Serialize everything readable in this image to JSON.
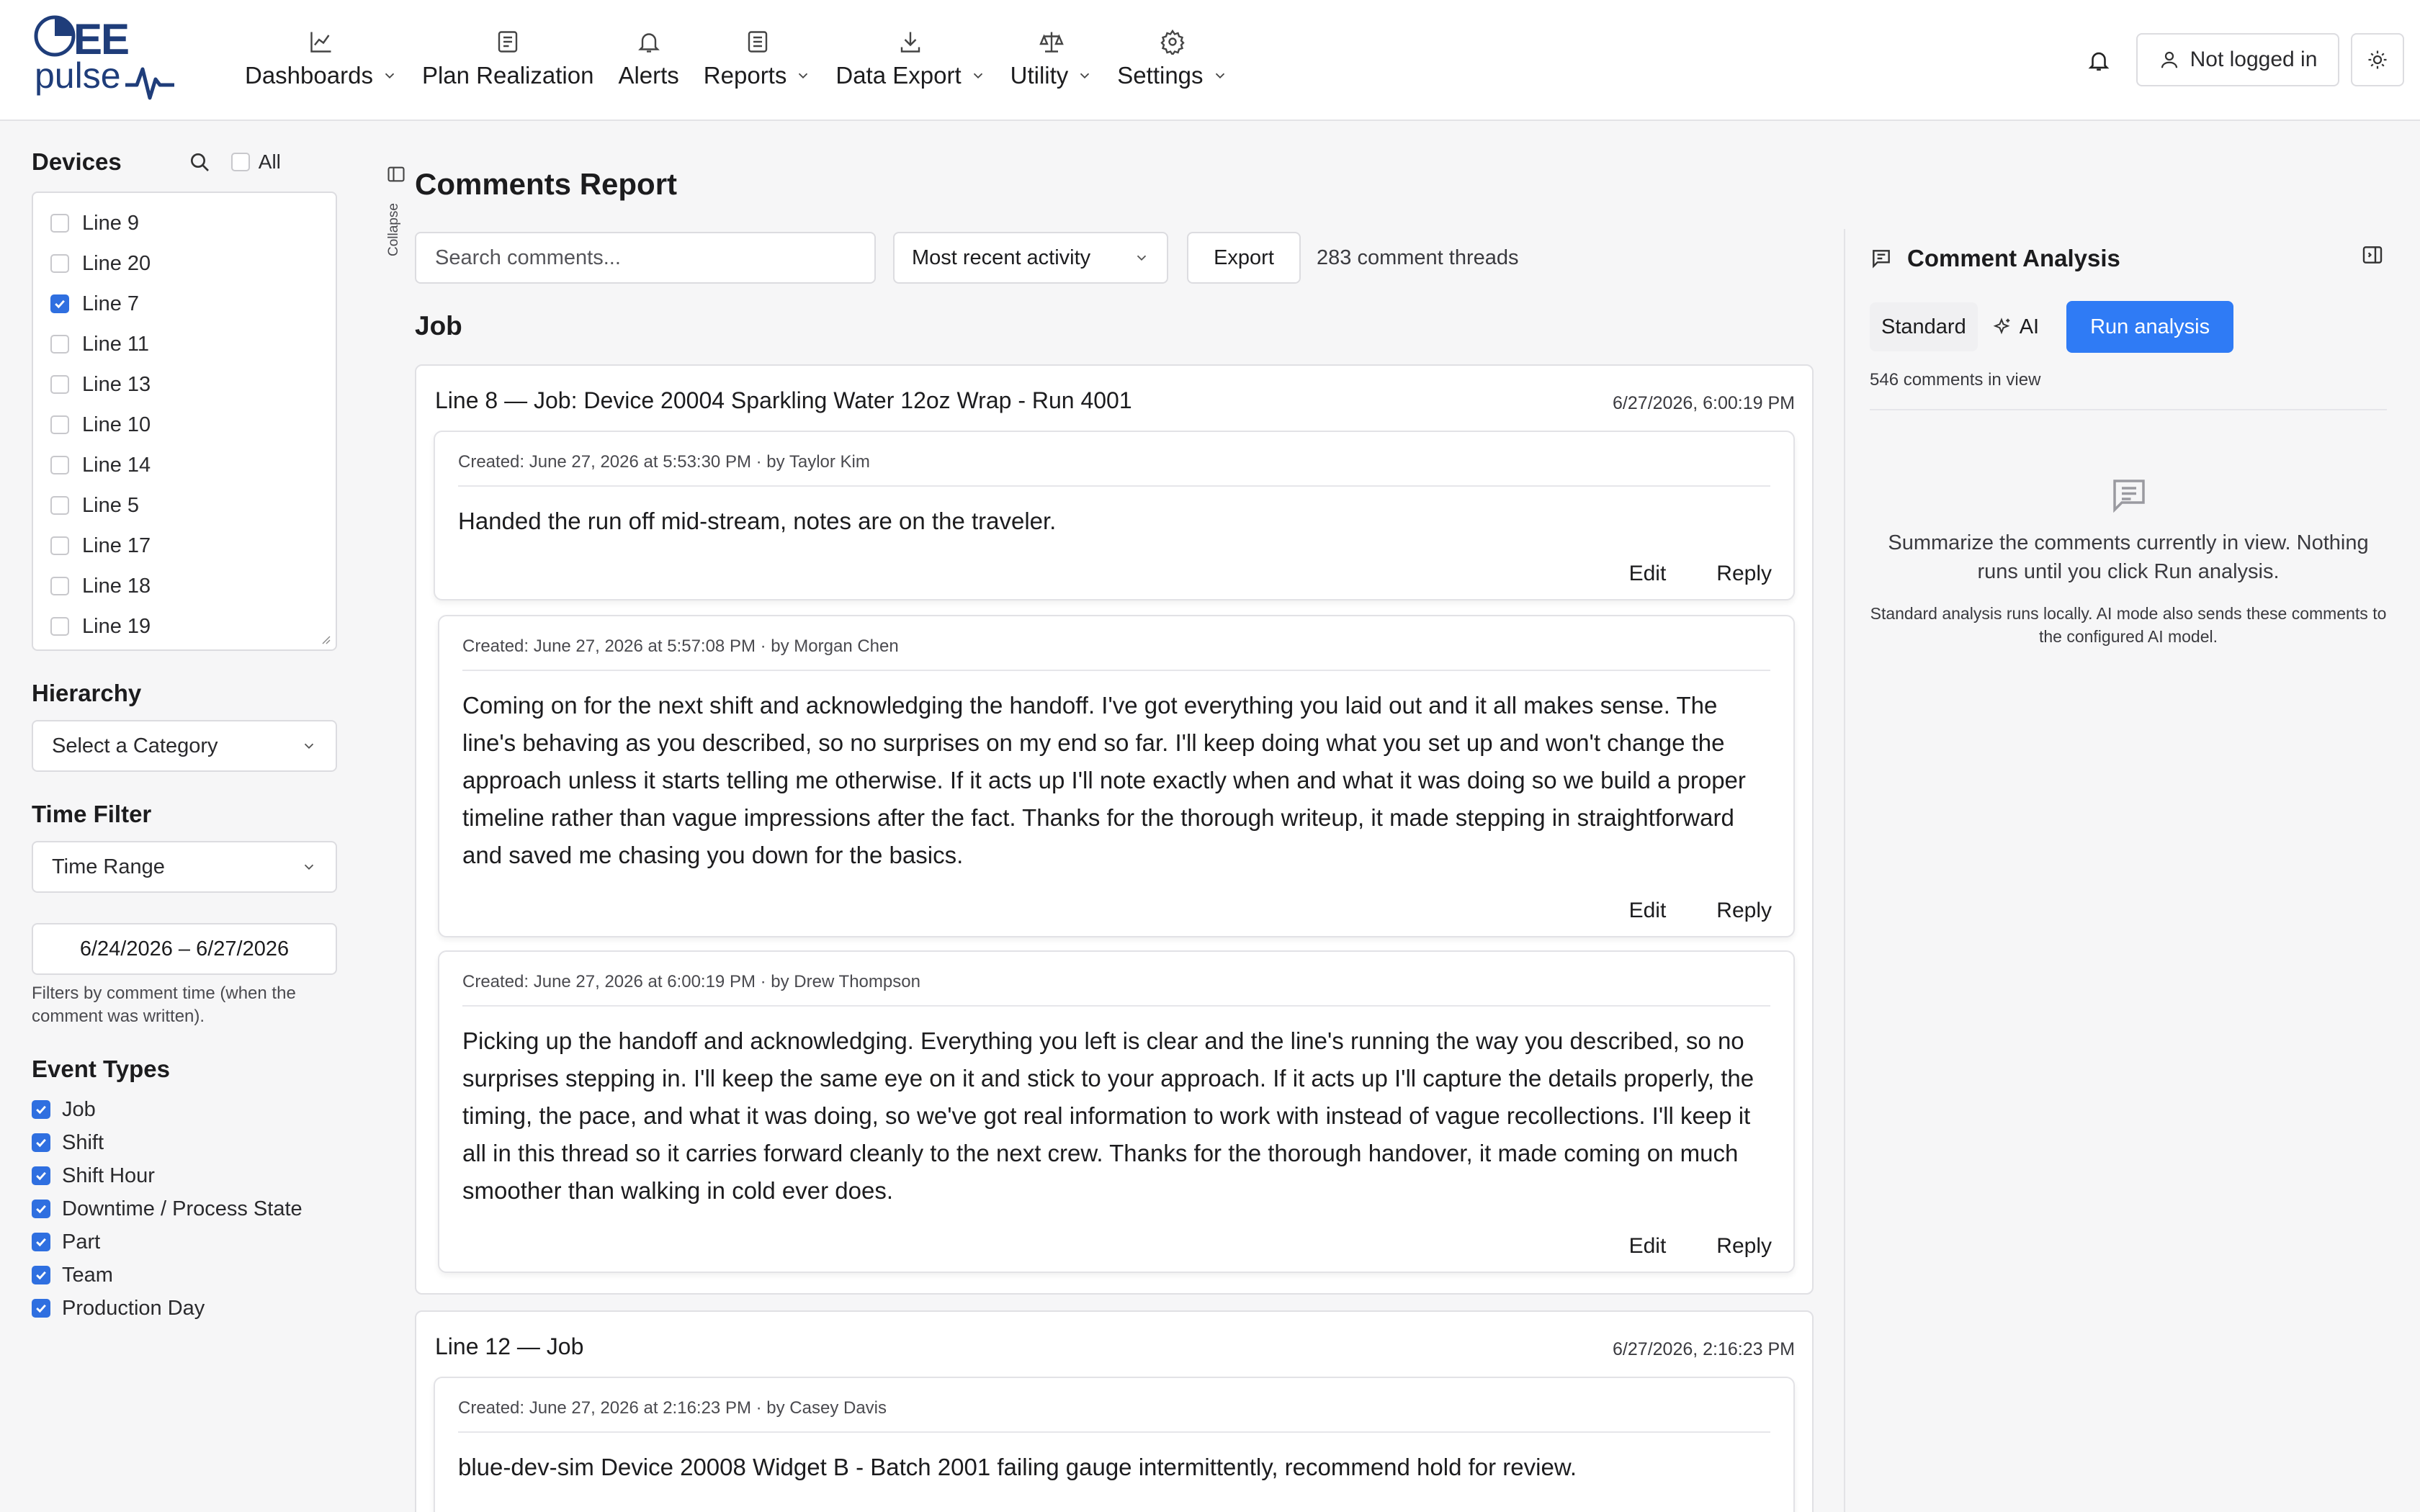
{
  "app": {
    "logo_top": "EE",
    "logo_bottom": "pulse"
  },
  "nav": {
    "items": [
      {
        "label": "Dashboards",
        "icon": "chart-line-icon",
        "has_dropdown": true
      },
      {
        "label": "Plan Realization",
        "icon": "document-icon",
        "has_dropdown": false
      },
      {
        "label": "Alerts",
        "icon": "bell-icon",
        "has_dropdown": false
      },
      {
        "label": "Reports",
        "icon": "report-icon",
        "has_dropdown": true
      },
      {
        "label": "Data Export",
        "icon": "download-icon",
        "has_dropdown": true
      },
      {
        "label": "Utility",
        "icon": "scale-icon",
        "has_dropdown": true
      },
      {
        "label": "Settings",
        "icon": "gear-icon",
        "has_dropdown": true
      }
    ],
    "login_label": "Not logged in"
  },
  "sidebar": {
    "devices_title": "Devices",
    "all_label": "All",
    "devices": [
      {
        "label": "Line 9",
        "checked": false
      },
      {
        "label": "Line 20",
        "checked": false
      },
      {
        "label": "Line 7",
        "checked": true
      },
      {
        "label": "Line 11",
        "checked": false
      },
      {
        "label": "Line 13",
        "checked": false
      },
      {
        "label": "Line 10",
        "checked": false
      },
      {
        "label": "Line 14",
        "checked": false
      },
      {
        "label": "Line 5",
        "checked": false
      },
      {
        "label": "Line 17",
        "checked": false
      },
      {
        "label": "Line 18",
        "checked": false
      },
      {
        "label": "Line 19",
        "checked": false
      }
    ],
    "hierarchy_title": "Hierarchy",
    "hierarchy_value": "Select a Category",
    "time_title": "Time Filter",
    "time_value": "Time Range",
    "date_range": "6/24/2026 – 6/27/2026",
    "time_hint": "Filters by comment time (when the comment was written).",
    "event_title": "Event Types",
    "event_types": [
      {
        "label": "Job",
        "checked": true
      },
      {
        "label": "Shift",
        "checked": true
      },
      {
        "label": "Shift Hour",
        "checked": true
      },
      {
        "label": "Downtime / Process State",
        "checked": true
      },
      {
        "label": "Part",
        "checked": true
      },
      {
        "label": "Team",
        "checked": true
      },
      {
        "label": "Production Day",
        "checked": true
      }
    ]
  },
  "collapse_label": "Collapse",
  "main": {
    "title": "Comments Report",
    "search_placeholder": "Search comments...",
    "sort_value": "Most recent activity",
    "export_label": "Export",
    "thread_count": "283 comment threads",
    "group_title": "Job",
    "threads": [
      {
        "title": "Line 8 — Job: Device 20004 Sparkling Water 12oz Wrap - Run 4001",
        "time": "6/27/2026, 6:00:19 PM",
        "comments": [
          {
            "meta": "Created: June 27, 2026 at 5:53:30 PM · by Taylor Kim",
            "body": "Handed the run off mid-stream, notes are on the traveler."
          },
          {
            "meta": "Created: June 27, 2026 at 5:57:08 PM · by Morgan Chen",
            "body": "Coming on for the next shift and acknowledging the handoff. I've got everything you laid out and it all makes sense. The line's behaving as you described, so no surprises on my end so far. I'll keep doing what you set up and won't change the approach unless it starts telling me otherwise. If it acts up I'll note exactly when and what it was doing so we build a proper timeline rather than vague impressions after the fact. Thanks for the thorough writeup, it made stepping in straightforward and saved me chasing you down for the basics."
          },
          {
            "meta": "Created: June 27, 2026 at 6:00:19 PM · by Drew Thompson",
            "body": "Picking up the handoff and acknowledging. Everything you left is clear and the line's running the way you described, so no surprises stepping in. I'll keep the same eye on it and stick to your approach. If it acts up I'll capture the details properly, the timing, the pace, and what it was doing, so we've got real information to work with instead of vague recollections. I'll keep it all in this thread so it carries forward cleanly to the next crew. Thanks for the thorough handover, it made coming on much smoother than walking in cold ever does."
          }
        ]
      },
      {
        "title": "Line 12 — Job",
        "time": "6/27/2026, 2:16:23 PM",
        "comments": [
          {
            "meta": "Created: June 27, 2026 at 2:16:23 PM · by Casey Davis",
            "body": "blue-dev-sim Device 20008 Widget B - Batch 2001 failing gauge intermittently, recommend hold for review."
          }
        ]
      }
    ],
    "edit_label": "Edit",
    "reply_label": "Reply"
  },
  "analysis": {
    "title": "Comment Analysis",
    "standard_label": "Standard",
    "ai_label": "AI",
    "run_label": "Run analysis",
    "count": "546 comments in view",
    "empty_text": "Summarize the comments currently in view. Nothing runs until you click Run analysis.",
    "empty_sub": "Standard analysis runs locally. AI mode also sends these comments to the configured AI model."
  },
  "colors": {
    "accent": "#2f7bf5",
    "checkbox": "#2f6fe0",
    "logo": "#1f3d7a"
  }
}
